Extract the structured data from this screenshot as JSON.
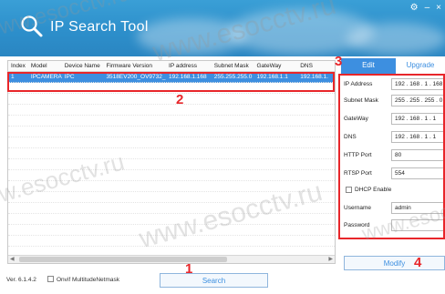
{
  "window": {
    "title": "IP Search Tool",
    "controls": [
      "⚙",
      "–",
      "×"
    ]
  },
  "device_table": {
    "columns": [
      "Index",
      "Model",
      "Device Name",
      "Firmware Version",
      "IP address",
      "Subnet Mask",
      "GateWay",
      "DNS"
    ],
    "rows": [
      [
        "1",
        "IPCAMERA",
        "IPC",
        "3518EV200_OV9732_...",
        "192.168.1.168",
        "255.255.255.0",
        "192.168.1.1",
        "192.168.1."
      ]
    ]
  },
  "tabs": {
    "edit": "Edit",
    "upgrade": "Upgrade"
  },
  "form": {
    "ip_label": "IP Address",
    "ip_value": "192 . 168 . 1 . 168",
    "mask_label": "Subnet Mask",
    "mask_value": "255 . 255 . 255 . 0",
    "gateway_label": "GateWay",
    "gateway_value": "192 . 168 . 1 . 1",
    "dns_label": "DNS",
    "dns_value": "192 . 168 . 1 . 1",
    "http_label": "HTTP Port",
    "http_value": "80",
    "rtsp_label": "RTSP Port",
    "rtsp_value": "554",
    "dhcp_label": "DHCP Enable",
    "username_label": "Username",
    "username_value": "admin",
    "password_label": "Password",
    "password_value": ""
  },
  "bottom": {
    "version": "Ver. 6.1.4.2",
    "onvif_label": "Onvif MultitudeNetmask",
    "search_label": "Search",
    "modify_label": "Modify"
  },
  "annotations": {
    "n1": "1",
    "n2": "2",
    "n3": "3",
    "n4": "4"
  },
  "watermark": "www.esocctv.ru",
  "colors": {
    "titlebar": "#2d8fcb",
    "accent": "#3d8fe0",
    "annotation": "#e8262a"
  }
}
